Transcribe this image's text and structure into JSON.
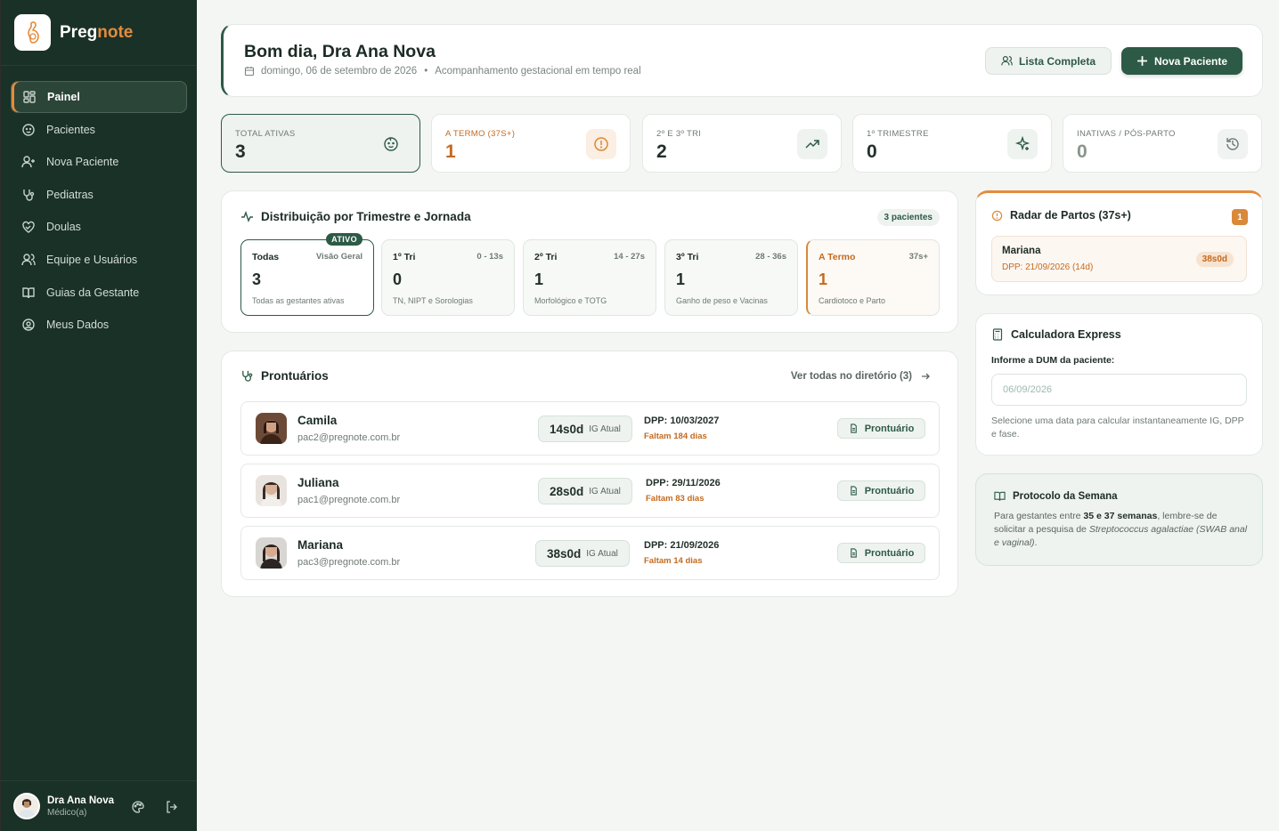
{
  "brand": {
    "name_main": "Preg",
    "name_accent": "note"
  },
  "nav": {
    "items": [
      {
        "label": "Painel",
        "icon": "dashboard-icon"
      },
      {
        "label": "Pacientes",
        "icon": "baby-icon"
      },
      {
        "label": "Nova Paciente",
        "icon": "user-plus-icon"
      },
      {
        "label": "Pediatras",
        "icon": "stethoscope-icon"
      },
      {
        "label": "Doulas",
        "icon": "heart-handshake-icon"
      },
      {
        "label": "Equipe e Usuários",
        "icon": "users-icon"
      },
      {
        "label": "Guias da Gestante",
        "icon": "book-icon"
      },
      {
        "label": "Meus Dados",
        "icon": "user-circle-icon"
      }
    ]
  },
  "user": {
    "name": "Dra Ana Nova",
    "role": "Médico(a)"
  },
  "header": {
    "title": "Bom dia, Dra Ana Nova",
    "date": "domingo, 06 de setembro de 2026",
    "separator": "•",
    "subtitle": "Acompanhamento gestacional em tempo real",
    "list_button": "Lista Completa",
    "new_button": "Nova Paciente"
  },
  "stats": [
    {
      "label": "TOTAL ATIVAS",
      "value": "3",
      "icon": "baby-face-icon"
    },
    {
      "label": "A TERMO (37S+)",
      "value": "1",
      "icon": "alert-circle-icon"
    },
    {
      "label": "2º E 3º TRI",
      "value": "2",
      "icon": "trending-up-icon"
    },
    {
      "label": "1º TRIMESTRE",
      "value": "0",
      "icon": "sparkles-icon"
    },
    {
      "label": "INATIVAS / PÓS-PARTO",
      "value": "0",
      "icon": "history-icon"
    }
  ],
  "distribution": {
    "title": "Distribuição por Trimestre e Jornada",
    "count_pill": "3 pacientes",
    "cards": [
      {
        "name": "Todas",
        "range": "Visão Geral",
        "value": "3",
        "desc": "Todas as gestantes ativas",
        "badge": "ATIVO"
      },
      {
        "name": "1º Tri",
        "range": "0 - 13s",
        "value": "0",
        "desc": "TN, NIPT e Sorologias"
      },
      {
        "name": "2º Tri",
        "range": "14 - 27s",
        "value": "1",
        "desc": "Morfológico e TOTG"
      },
      {
        "name": "3º Tri",
        "range": "28 - 36s",
        "value": "1",
        "desc": "Ganho de peso e Vacinas"
      },
      {
        "name": "A Termo",
        "range": "37s+",
        "value": "1",
        "desc": "Cardiotoco e Parto"
      }
    ]
  },
  "records": {
    "title": "Prontuários",
    "see_all": "Ver todas no diretório (3)",
    "ig_label": "IG Atual",
    "button_label": "Prontuário",
    "patients": [
      {
        "name": "Camila",
        "email": "pac2@pregnote.com.br",
        "ig": "14s0d",
        "dpp": "DPP: 10/03/2027",
        "remaining": "Faltam 184 dias"
      },
      {
        "name": "Juliana",
        "email": "pac1@pregnote.com.br",
        "ig": "28s0d",
        "dpp": "DPP: 29/11/2026",
        "remaining": "Faltam 83 dias"
      },
      {
        "name": "Mariana",
        "email": "pac3@pregnote.com.br",
        "ig": "38s0d",
        "dpp": "DPP: 21/09/2026",
        "remaining": "Faltam 14 dias"
      }
    ]
  },
  "radar": {
    "title": "Radar de Partos (37s+)",
    "count": "1",
    "item": {
      "name": "Mariana",
      "dpp": "DPP: 21/09/2026 (14d)",
      "ig": "38s0d"
    }
  },
  "calculator": {
    "title": "Calculadora Express",
    "label": "Informe a DUM da paciente:",
    "placeholder": "06/09/2026",
    "help": "Selecione uma data para calcular instantaneamente IG, DPP e fase."
  },
  "protocol": {
    "title": "Protocolo da Semana",
    "text_1": "Para gestantes entre ",
    "text_bold": "35 e 37 semanas",
    "text_2": ", lembre-se de solicitar a pesquisa de ",
    "text_italic": "Streptococcus agalactiae (SWAB anal e vaginal)",
    "text_3": "."
  },
  "colors": {
    "primary": "#2d5a46",
    "accent": "#e58b3c",
    "sidebar": "#1a3127",
    "warning_text": "#c46a1f"
  }
}
